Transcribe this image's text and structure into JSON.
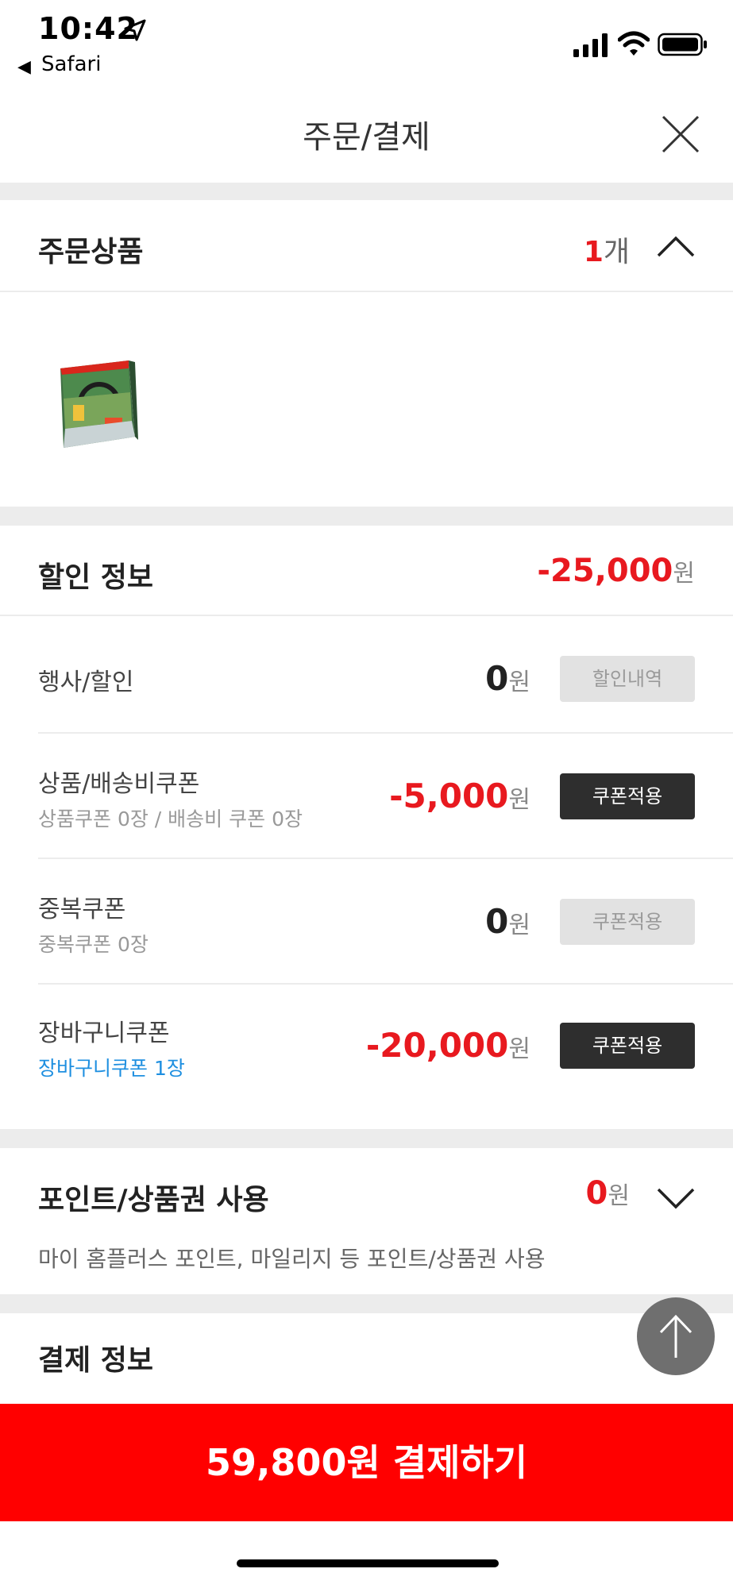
{
  "status_bar": {
    "time": "10:42",
    "back_app": "Safari"
  },
  "header": {
    "title": "주문/결제"
  },
  "order_items": {
    "title": "주문상품",
    "count": "1",
    "count_unit": "개"
  },
  "discount": {
    "title": "할인 정보",
    "total": "-25,000",
    "won": "원",
    "rows": [
      {
        "label": "행사/할인",
        "sub": "",
        "amount": "0",
        "button": "할인내역",
        "button_active": false
      },
      {
        "label": "상품/배송비쿠폰",
        "sub": "상품쿠폰 0장 / 배송비 쿠폰 0장",
        "amount": "-5,000",
        "button": "쿠폰적용",
        "button_active": true
      },
      {
        "label": "중복쿠폰",
        "sub": "중복쿠폰 0장",
        "amount": "0",
        "button": "쿠폰적용",
        "button_active": false
      },
      {
        "label": "장바구니쿠폰",
        "sub": "장바구니쿠폰 1장",
        "amount": "-20,000",
        "button": "쿠폰적용",
        "button_active": true
      }
    ]
  },
  "points": {
    "title": "포인트/상품권 사용",
    "amount": "0",
    "won": "원",
    "description": "마이 홈플러스 포인트, 마일리지 등 포인트/상품권 사용"
  },
  "payment_info": {
    "title": "결제 정보"
  },
  "pay_button": {
    "label": "59,800원 결제하기"
  },
  "colors": {
    "accent_red": "#e8191f",
    "pay_red": "#ff0000",
    "link_blue": "#1e8fe0",
    "dark_button": "#2e2e2e"
  }
}
